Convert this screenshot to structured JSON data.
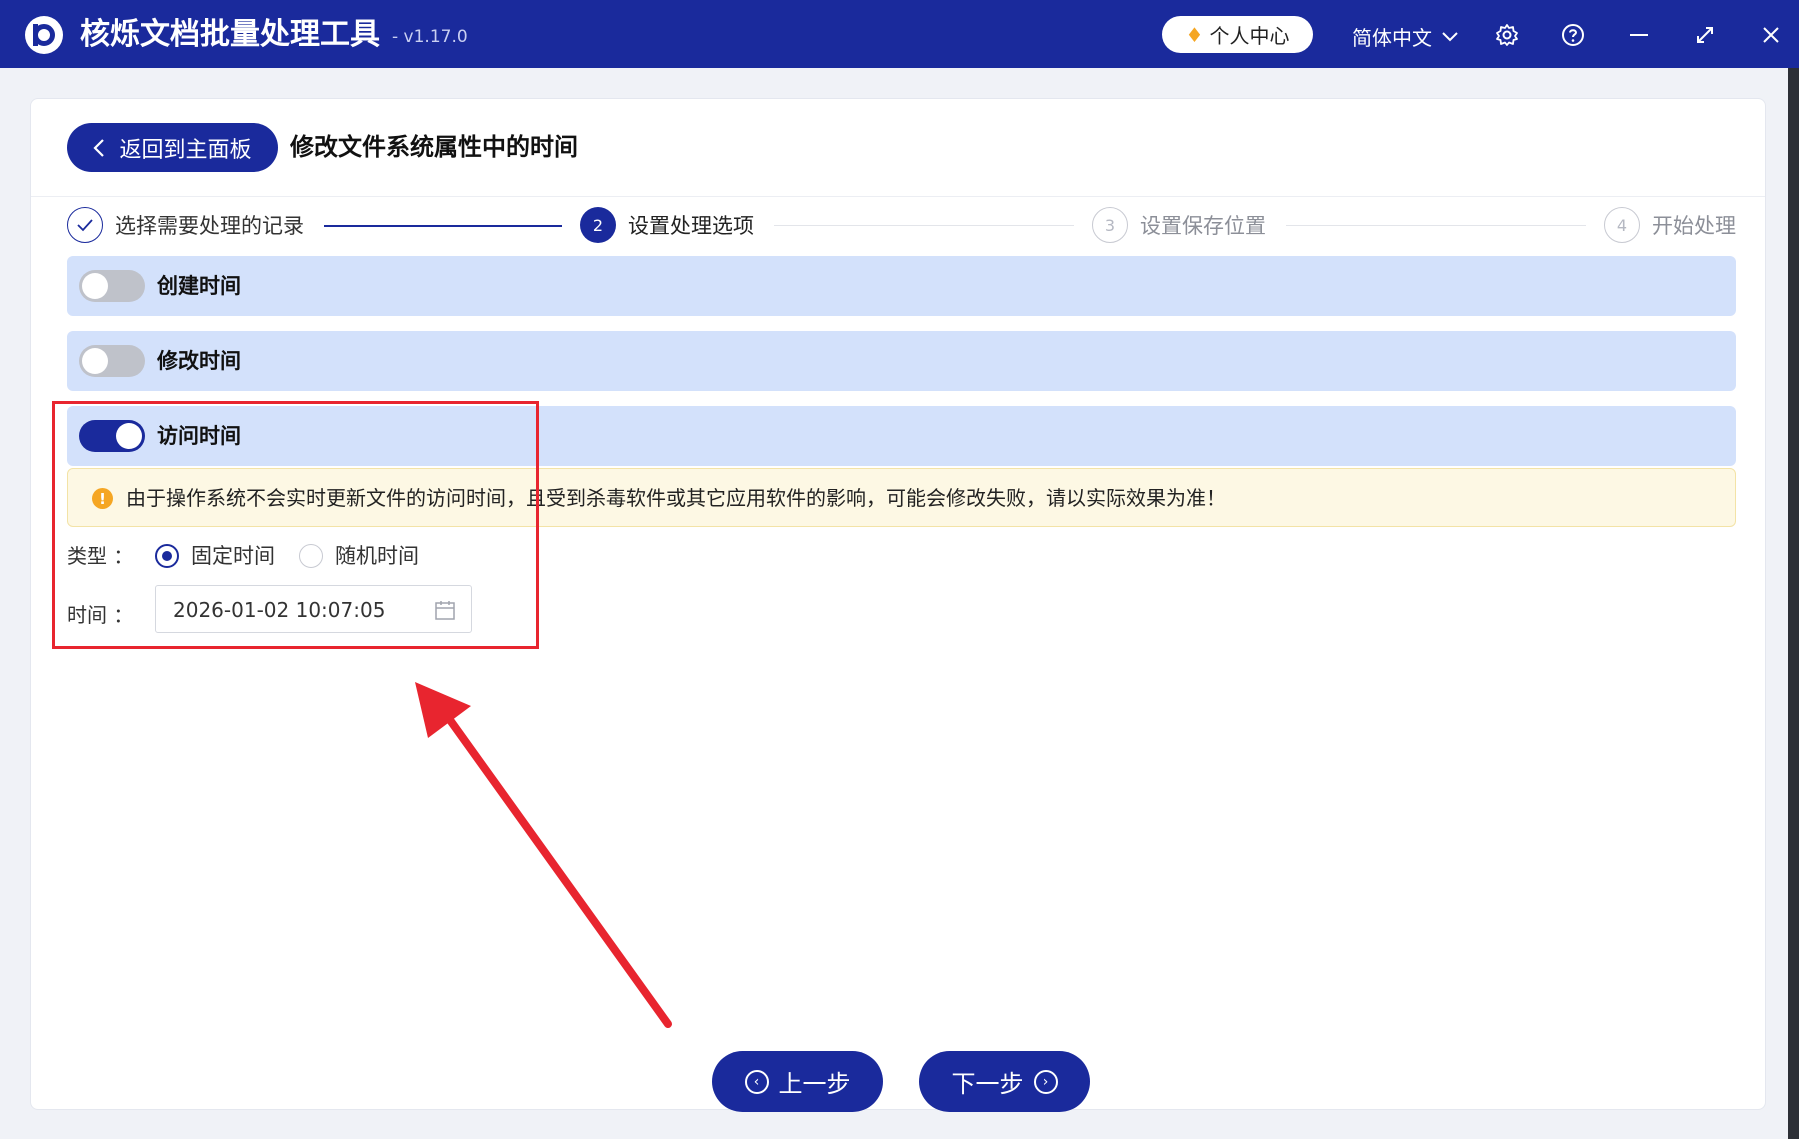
{
  "titlebar": {
    "app_name": "核烁文档批量处理工具",
    "version": "- v1.17.0",
    "user_center": "个人中心",
    "language": "简体中文",
    "icons": [
      "settings-icon",
      "help-icon",
      "minimize-icon",
      "maximize-icon",
      "close-icon"
    ]
  },
  "header": {
    "back_label": "返回到主面板",
    "page_title": "修改文件系统属性中的时间"
  },
  "steps": [
    {
      "number": "1",
      "label": "选择需要处理的记录",
      "state": "done"
    },
    {
      "number": "2",
      "label": "设置处理选项",
      "state": "active"
    },
    {
      "number": "3",
      "label": "设置保存位置",
      "state": "todo"
    },
    {
      "number": "4",
      "label": "开始处理",
      "state": "todo"
    }
  ],
  "options": [
    {
      "label": "创建时间",
      "enabled": false
    },
    {
      "label": "修改时间",
      "enabled": false
    },
    {
      "label": "访问时间",
      "enabled": true
    }
  ],
  "warning": "由于操作系统不会实时更新文件的访问时间，且受到杀毒软件或其它应用软件的影响，可能会修改失败，请以实际效果为准！",
  "type_field": {
    "label": "类型 ：",
    "options": [
      "固定时间",
      "随机时间"
    ],
    "selected": "固定时间"
  },
  "time_field": {
    "label": "时间 ：",
    "value": "2026-01-02 10:07:05"
  },
  "nav": {
    "prev_label": "上一步",
    "next_label": "下一步"
  },
  "colors": {
    "primary": "#1a2a9c",
    "option_bg": "#d3e1fb",
    "warning_bg": "#fdf8e4",
    "warning_icon": "#f5a623",
    "annotation_red": "#e8252f"
  }
}
